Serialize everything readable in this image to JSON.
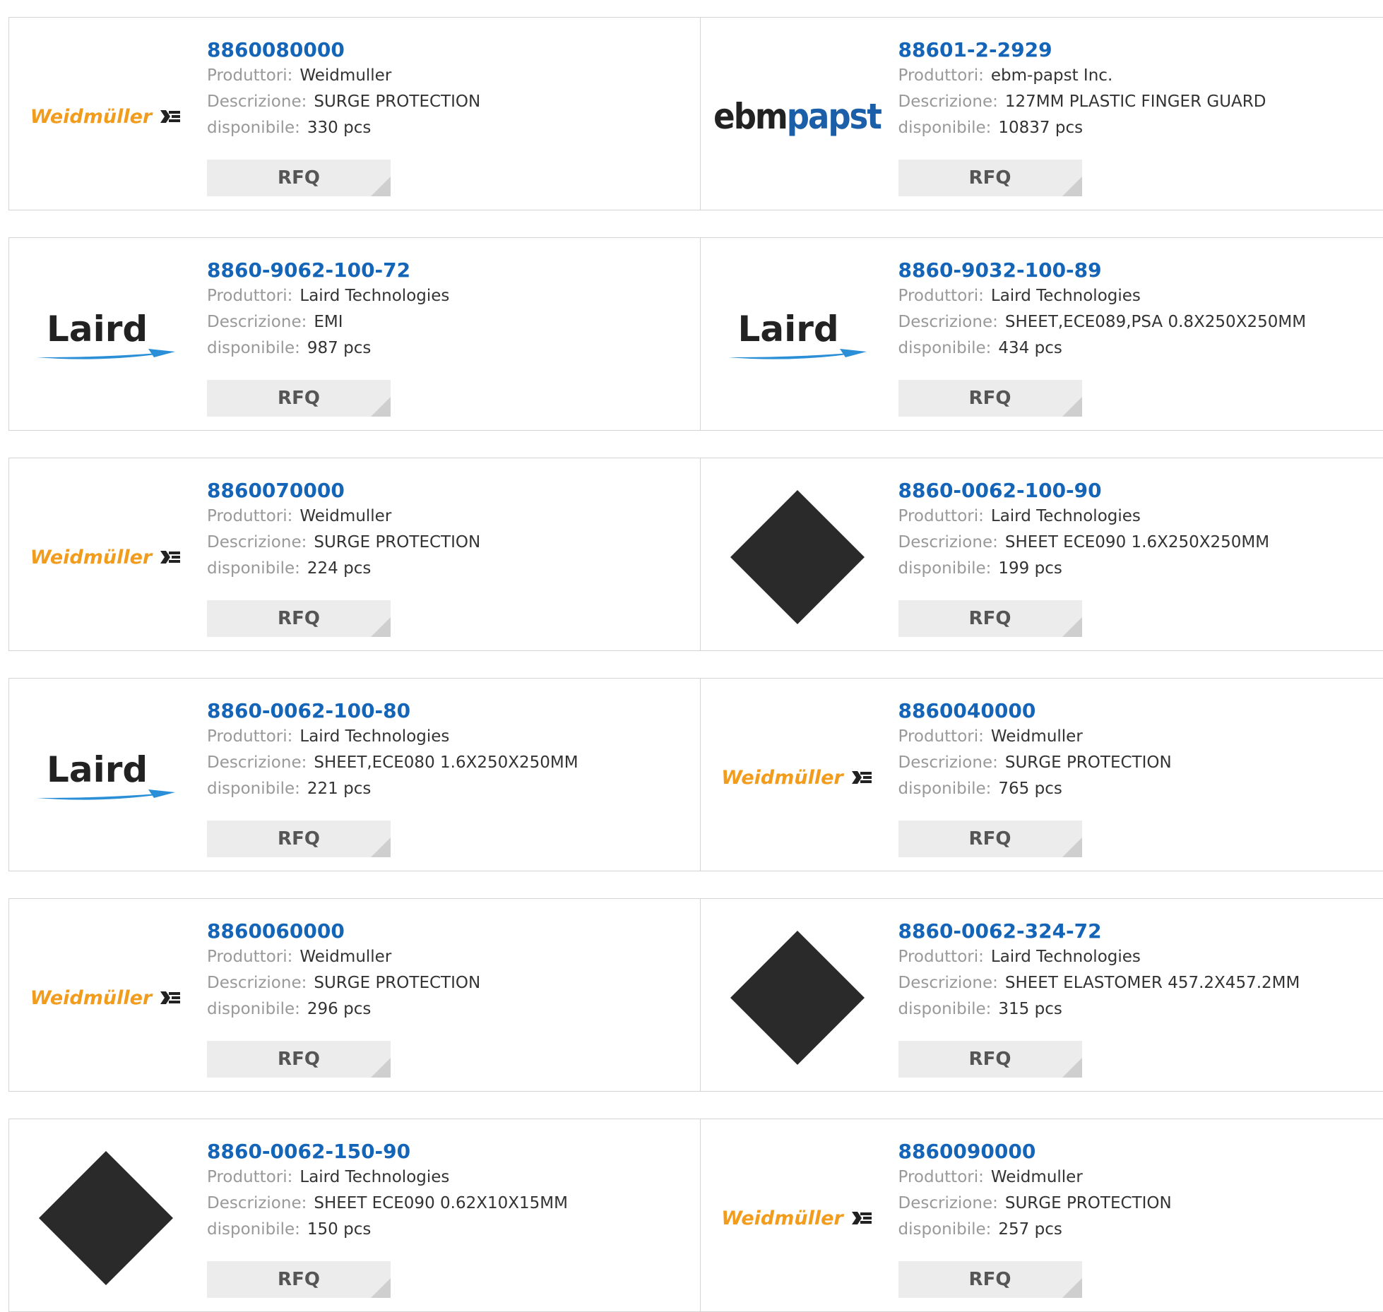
{
  "labels": {
    "manufacturer": "Produttori:",
    "description": "Descrizione:",
    "available": "disponibile:",
    "rfq": "RFQ"
  },
  "brand_logos": {
    "weidmuller": "Weidmüller",
    "laird": "Laird",
    "ebm": "ebm",
    "papst": "papst"
  },
  "colors": {
    "part_number": "#1464b8",
    "label": "#999999",
    "value": "#333333",
    "button_bg": "#ececec",
    "weidmuller_orange": "#f29c1e",
    "ebm_blue": "#1a5fa8"
  },
  "products": [
    {
      "part_number": "8860080000",
      "manufacturer": "Weidmuller",
      "description": "SURGE PROTECTION",
      "available": "330 pcs",
      "logo": "weidmuller-logo"
    },
    {
      "part_number": "88601-2-2929",
      "manufacturer": "ebm-papst Inc.",
      "description": "127MM PLASTIC FINGER GUARD",
      "available": "10837 pcs",
      "logo": "ebmpapst-logo"
    },
    {
      "part_number": "8860-9062-100-72",
      "manufacturer": "Laird Technologies",
      "description": "EMI",
      "available": "987 pcs",
      "logo": "laird-logo"
    },
    {
      "part_number": "8860-9032-100-89",
      "manufacturer": "Laird Technologies",
      "description": "SHEET,ECE089,PSA 0.8X250X250MM",
      "available": "434 pcs",
      "logo": "laird-logo"
    },
    {
      "part_number": "8860070000",
      "manufacturer": "Weidmuller",
      "description": "SURGE PROTECTION",
      "available": "224 pcs",
      "logo": "weidmuller-logo"
    },
    {
      "part_number": "8860-0062-100-90",
      "manufacturer": "Laird Technologies",
      "description": "SHEET ECE090 1.6X250X250MM",
      "available": "199 pcs",
      "logo": "sheet-product-image"
    },
    {
      "part_number": "8860-0062-100-80",
      "manufacturer": "Laird Technologies",
      "description": "SHEET,ECE080 1.6X250X250MM",
      "available": "221 pcs",
      "logo": "laird-logo"
    },
    {
      "part_number": "8860040000",
      "manufacturer": "Weidmuller",
      "description": "SURGE PROTECTION",
      "available": "765 pcs",
      "logo": "weidmuller-logo"
    },
    {
      "part_number": "8860060000",
      "manufacturer": "Weidmuller",
      "description": "SURGE PROTECTION",
      "available": "296 pcs",
      "logo": "weidmuller-logo"
    },
    {
      "part_number": "8860-0062-324-72",
      "manufacturer": "Laird Technologies",
      "description": "SHEET ELASTOMER 457.2X457.2MM",
      "available": "315 pcs",
      "logo": "sheet-product-image"
    },
    {
      "part_number": "8860-0062-150-90",
      "manufacturer": "Laird Technologies",
      "description": "SHEET ECE090 0.62X10X15MM",
      "available": "150 pcs",
      "logo": "sheet-product-image"
    },
    {
      "part_number": "8860090000",
      "manufacturer": "Weidmuller",
      "description": "SURGE PROTECTION",
      "available": "257 pcs",
      "logo": "weidmuller-logo"
    }
  ]
}
